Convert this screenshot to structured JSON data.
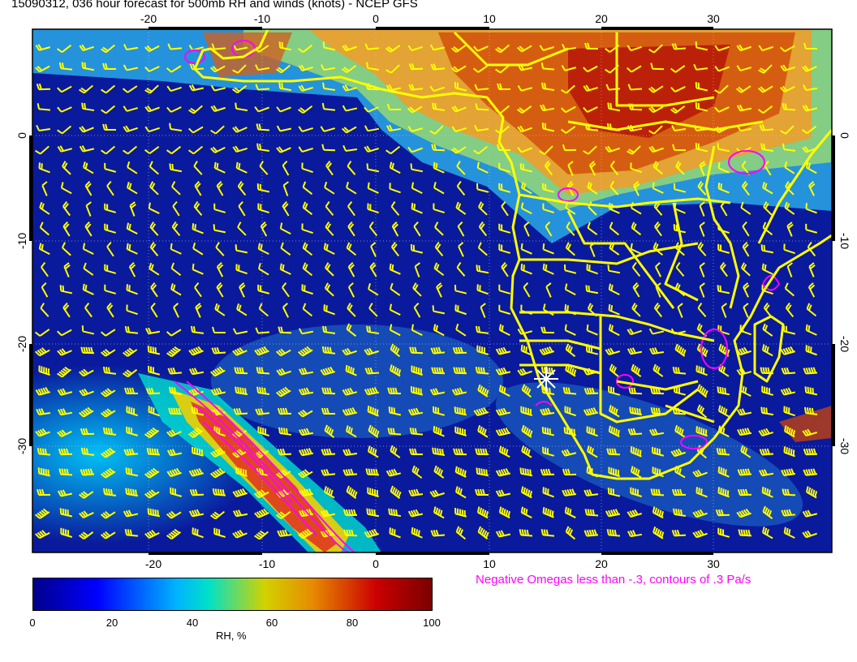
{
  "title": "15090312, 036 hour forecast for 500mb RH and winds (knots) - NCEP GFS",
  "map": {
    "lon_ticks": [
      "-20",
      "-10",
      "0",
      "10",
      "20",
      "30"
    ],
    "lat_ticks": [
      "0",
      "-10",
      "-20",
      "-30"
    ],
    "lon_range": [
      -30,
      40
    ],
    "lat_range": [
      -40,
      10
    ],
    "marker": "star-marker",
    "colors": {
      "coastline": "#ffff00",
      "wind_barb": "#ffff00",
      "omega_contour": "#ff00ff",
      "grid": "#c8c8ff"
    }
  },
  "omega_note": "Negative Omegas less than -.3, contours of .3 Pa/s",
  "colorbar": {
    "ticks": [
      "0",
      "20",
      "40",
      "60",
      "80",
      "100"
    ],
    "label": "RH, %",
    "colors": [
      "#00008b",
      "#0000ff",
      "#00b4ff",
      "#00e0c8",
      "#d2d200",
      "#e68c00",
      "#cc0000",
      "#7a0000"
    ]
  }
}
